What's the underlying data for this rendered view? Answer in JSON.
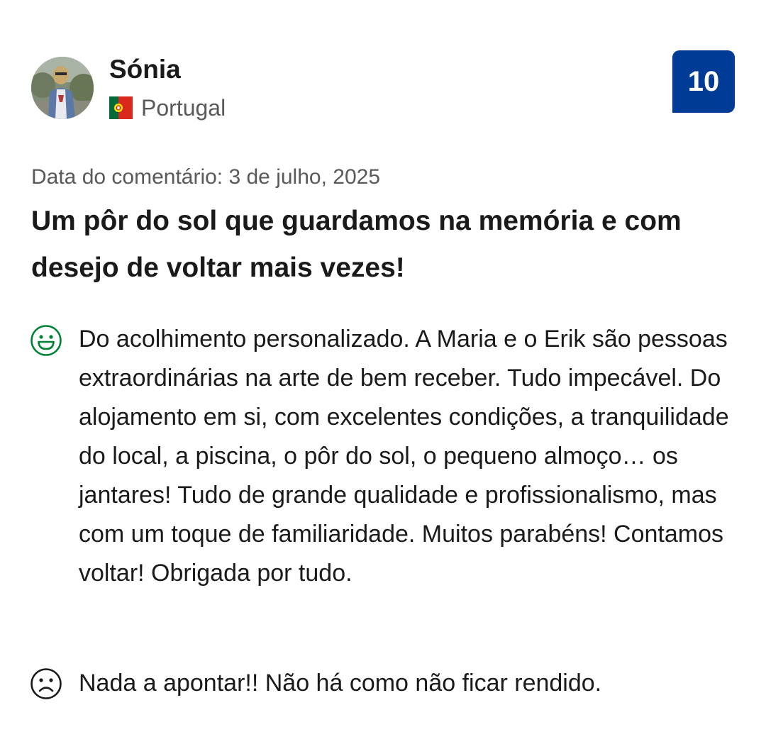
{
  "reviewer": {
    "name": "Sónia",
    "country": "Portugal",
    "flag_icon": "portugal-flag-icon",
    "avatar_icon": "reviewer-photo"
  },
  "score": {
    "value": "10",
    "color": "#003b95"
  },
  "review": {
    "date": "Data do comentário: 3 de julho, 2025",
    "title": "Um pôr do sol que guardamos na memória e com desejo de voltar mais vezes!",
    "positive": {
      "icon": "smiley-face-icon",
      "icon_color": "#008234",
      "text": "Do acolhimento personalizado. A Maria e o Erik são pessoas extraordinárias na arte de bem receber. Tudo impecável. Do alojamento em si, com excelentes condições, a tranquilidade do local, a piscina, o pôr do sol, o pequeno almoço… os jantares! Tudo de grande qualidade e profissionalismo, mas com um toque de familiaridade. Muitos parabéns! Contamos voltar! Obrigada por tudo."
    },
    "negative": {
      "icon": "sad-face-icon",
      "icon_color": "#1a1a1a",
      "text": "Nada a apontar!! Não há como não ficar rendido."
    }
  }
}
